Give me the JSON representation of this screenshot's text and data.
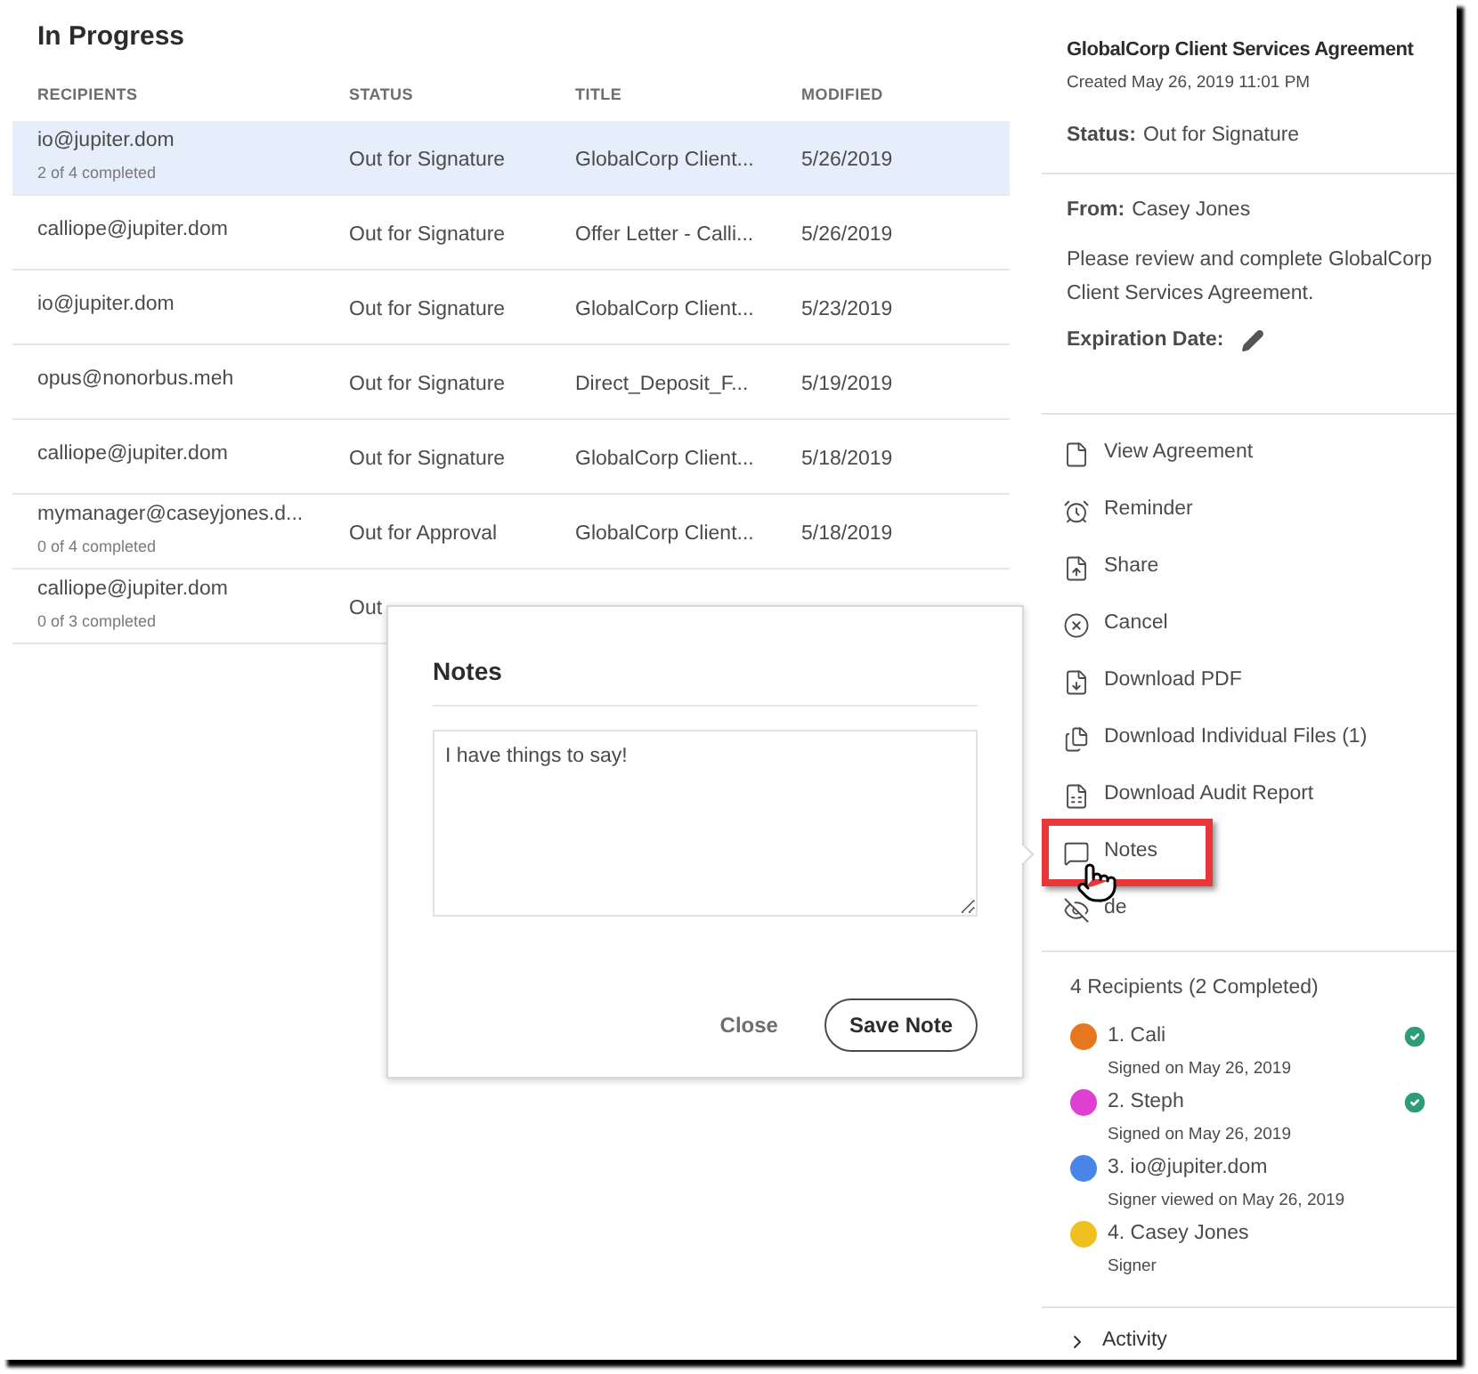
{
  "list": {
    "title": "In Progress",
    "columns": [
      "RECIPIENTS",
      "STATUS",
      "TITLE",
      "MODIFIED"
    ],
    "rows": [
      {
        "recipient": "io@jupiter.dom",
        "progress": "2 of 4 completed",
        "status": "Out for Signature",
        "title": "GlobalCorp Client...",
        "modified": "5/26/2019",
        "selected": true
      },
      {
        "recipient": "calliope@jupiter.dom",
        "status": "Out for Signature",
        "title": "Offer Letter - Calli...",
        "modified": "5/26/2019",
        "selected": false
      },
      {
        "recipient": "io@jupiter.dom",
        "status": "Out for Signature",
        "title": "GlobalCorp Client...",
        "modified": "5/23/2019",
        "selected": false
      },
      {
        "recipient": "opus@nonorbus.meh",
        "status": "Out for Signature",
        "title": "Direct_Deposit_F...",
        "modified": "5/19/2019",
        "selected": false
      },
      {
        "recipient": "calliope@jupiter.dom",
        "status": "Out for Signature",
        "title": "GlobalCorp Client...",
        "modified": "5/18/2019",
        "selected": false
      },
      {
        "recipient": "mymanager@caseyjones.d...",
        "progress": "0 of 4 completed",
        "status": "Out for Approval",
        "title": "GlobalCorp Client...",
        "modified": "5/18/2019",
        "selected": false
      },
      {
        "recipient": "calliope@jupiter.dom",
        "progress": "0 of 3 completed",
        "status": "Out",
        "selected": false
      }
    ]
  },
  "notes_popup": {
    "title": "Notes",
    "value": "I have things to say!",
    "buttons": [
      {
        "label": "Close",
        "kind": "text"
      },
      {
        "label": "Save Note",
        "kind": "outline"
      }
    ]
  },
  "details": {
    "title": "GlobalCorp Client Services Agreement",
    "created": "Created May 26, 2019 11:01 PM",
    "status_label": "Status:",
    "status": "Out for Signature",
    "from_label": "From:",
    "from": "Casey Jones",
    "message": "Please review and complete GlobalCorp Client Services Agreement.",
    "expiration_label": "Expiration Date:"
  },
  "actions": [
    {
      "label": "View Agreement",
      "kind": "file",
      "highlighted": false
    },
    {
      "label": "Reminder",
      "kind": "alarm",
      "highlighted": false
    },
    {
      "label": "Share",
      "kind": "share",
      "highlighted": false
    },
    {
      "label": "Cancel",
      "kind": "cancel",
      "highlighted": false
    },
    {
      "label": "Download PDF",
      "kind": "pdf",
      "highlighted": false
    },
    {
      "label": "Download Individual Files (1)",
      "kind": "files",
      "highlighted": false
    },
    {
      "label": "Download Audit Report",
      "kind": "report",
      "highlighted": false
    },
    {
      "label": "Notes",
      "kind": "note",
      "highlighted": true
    },
    {
      "label": "de",
      "kind": "hide",
      "highlighted": false
    }
  ],
  "recipients": {
    "heading": "4 Recipients (2 Completed)",
    "items": [
      {
        "name": "1. Cali",
        "detail": "Signed on May 26, 2019",
        "color": "#e8761e",
        "completed": true
      },
      {
        "name": "2. Steph",
        "detail": "Signed on May 26, 2019",
        "color": "#e040d0",
        "completed": true
      },
      {
        "name": "3. io@jupiter.dom",
        "detail": "Signer viewed on May 26, 2019",
        "color": "#4a86e8",
        "completed": false
      },
      {
        "name": "4. Casey Jones",
        "detail": "Signer",
        "color": "#f0c020",
        "completed": false
      }
    ]
  },
  "activity": {
    "label": "Activity",
    "expanded": false
  }
}
